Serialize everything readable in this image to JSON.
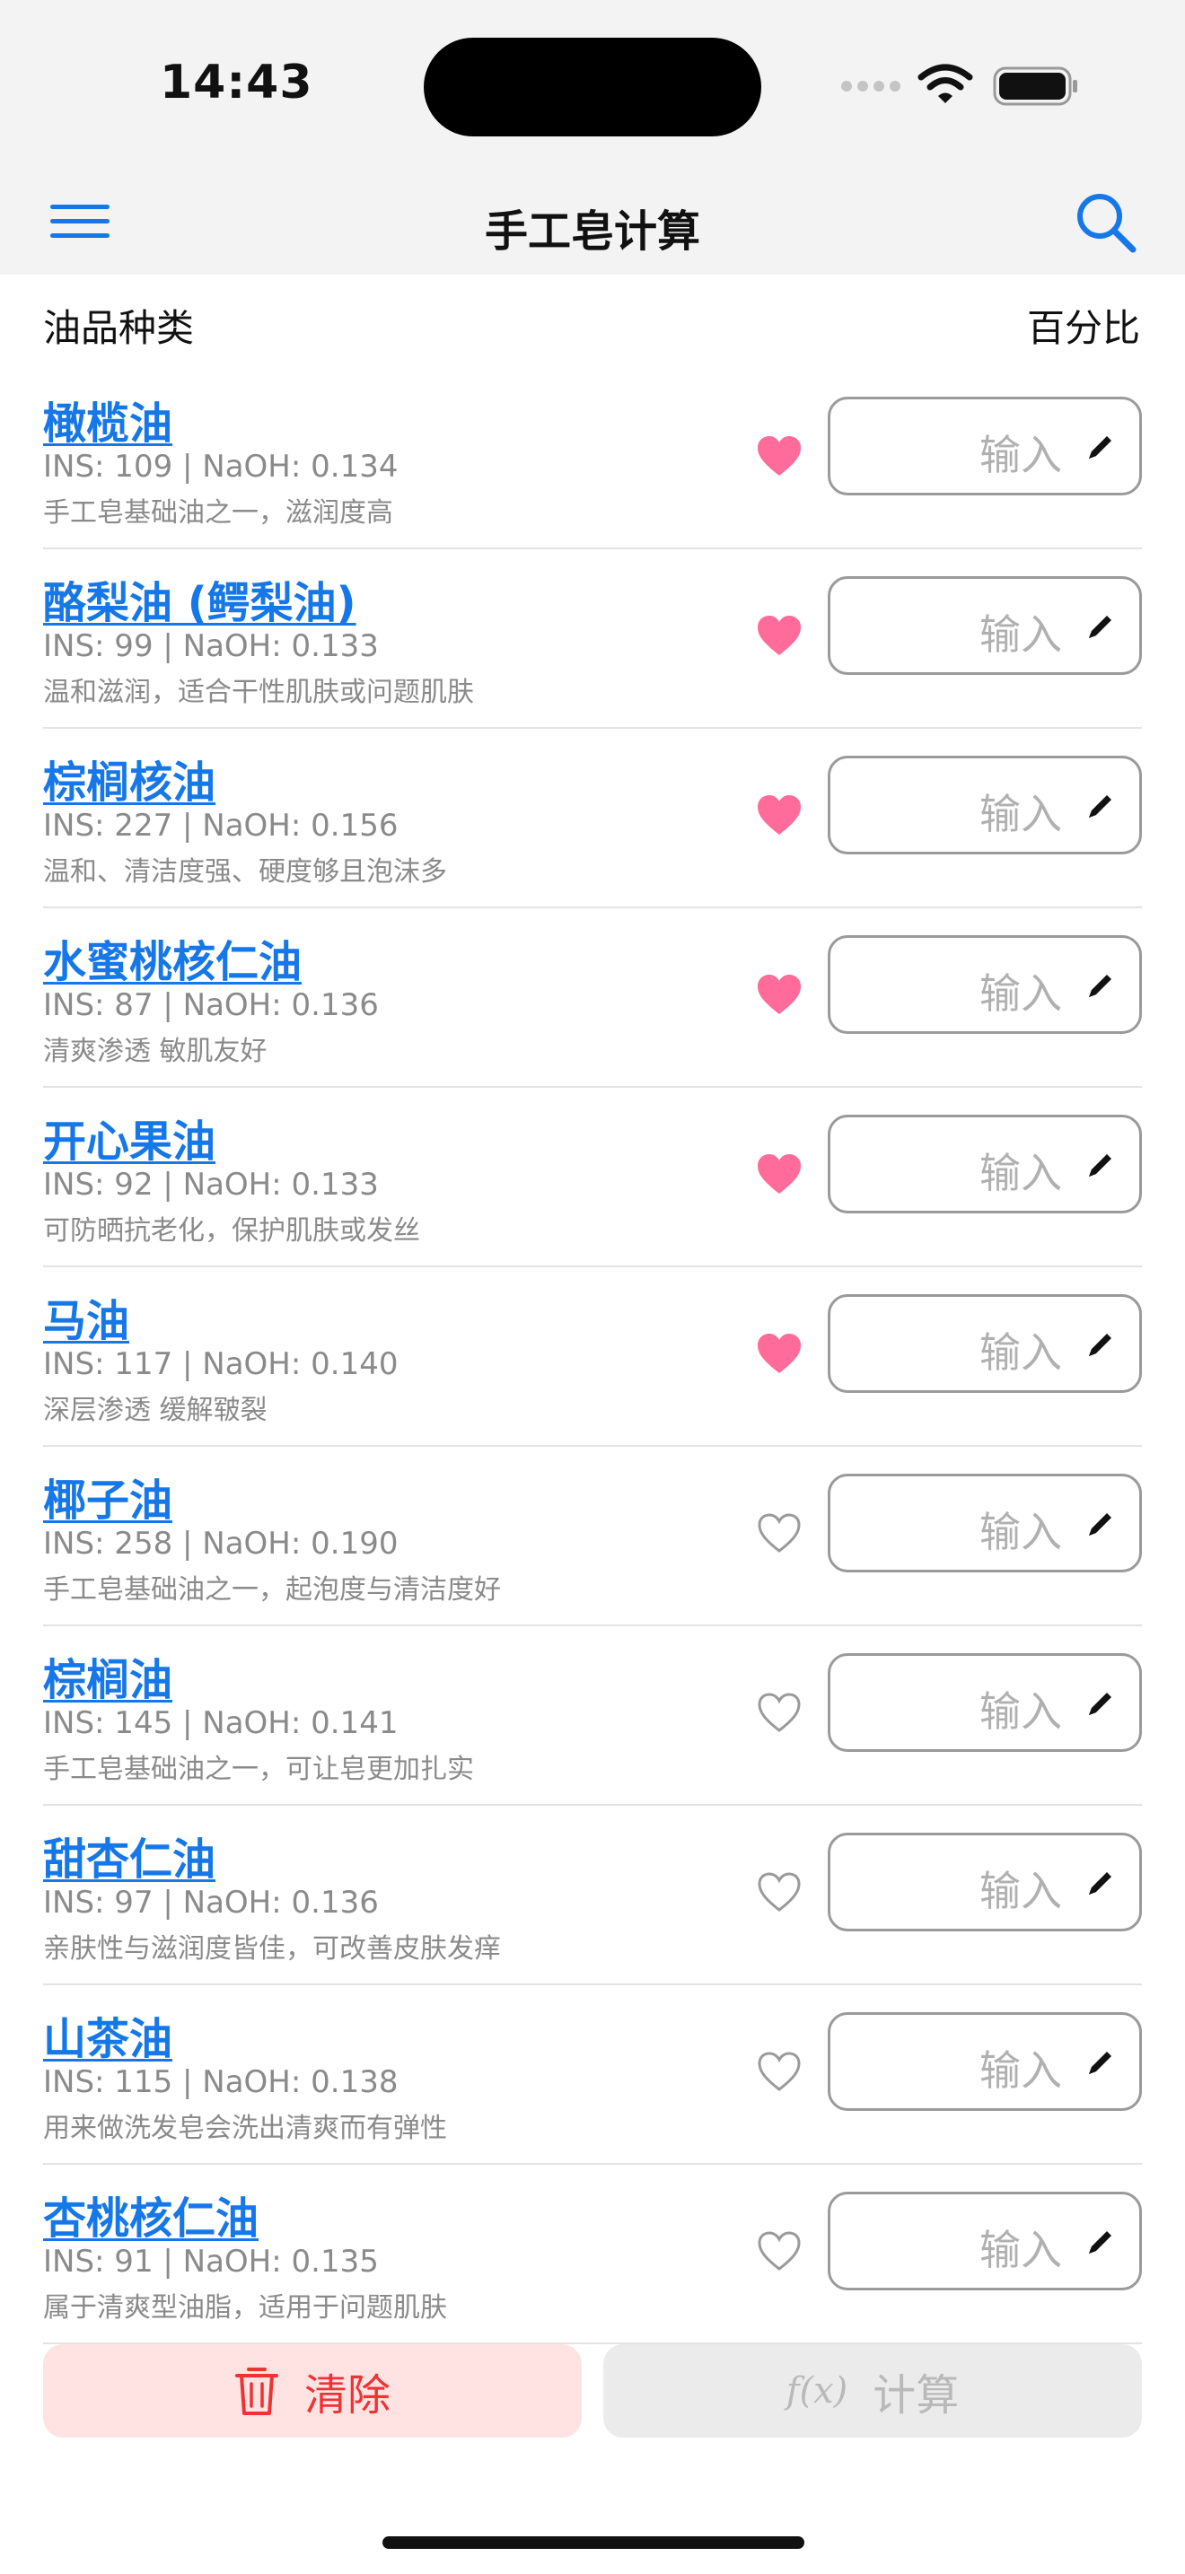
{
  "status": {
    "time": "14:43"
  },
  "nav": {
    "title": "手工皂计算"
  },
  "header": {
    "left": "油品种类",
    "right": "百分比"
  },
  "oils": [
    {
      "name": "橄榄油",
      "stats": "INS: 109 | NaOH: 0.134",
      "desc": "手工皂基础油之一，滋润度高",
      "favorite": true,
      "placeholder": "输入"
    },
    {
      "name": "酪梨油 (鳄梨油)",
      "stats": "INS: 99 | NaOH: 0.133",
      "desc": "温和滋润，适合干性肌肤或问题肌肤",
      "favorite": true,
      "placeholder": "输入"
    },
    {
      "name": "棕榈核油",
      "stats": "INS: 227 | NaOH: 0.156",
      "desc": "温和、清洁度强、硬度够且泡沫多",
      "favorite": true,
      "placeholder": "输入"
    },
    {
      "name": "水蜜桃核仁油",
      "stats": "INS: 87 | NaOH: 0.136",
      "desc": "清爽渗透 敏肌友好",
      "favorite": true,
      "placeholder": "输入"
    },
    {
      "name": "开心果油",
      "stats": "INS: 92 | NaOH: 0.133",
      "desc": "可防晒抗老化，保护肌肤或发丝",
      "favorite": true,
      "placeholder": "输入"
    },
    {
      "name": "马油",
      "stats": "INS: 117 | NaOH: 0.140",
      "desc": "深层渗透 缓解皲裂",
      "favorite": true,
      "placeholder": "输入"
    },
    {
      "name": "椰子油",
      "stats": "INS: 258 | NaOH: 0.190",
      "desc": "手工皂基础油之一，起泡度与清洁度好",
      "favorite": false,
      "placeholder": "输入"
    },
    {
      "name": "棕榈油",
      "stats": "INS: 145 | NaOH: 0.141",
      "desc": "手工皂基础油之一，可让皂更加扎实",
      "favorite": false,
      "placeholder": "输入"
    },
    {
      "name": "甜杏仁油",
      "stats": "INS: 97 | NaOH: 0.136",
      "desc": "亲肤性与滋润度皆佳，可改善皮肤发痒",
      "favorite": false,
      "placeholder": "输入"
    },
    {
      "name": "山茶油",
      "stats": "INS: 115 | NaOH: 0.138",
      "desc": "用来做洗发皂会洗出清爽而有弹性",
      "favorite": false,
      "placeholder": "输入"
    },
    {
      "name": "杏桃核仁油",
      "stats": "INS: 91 | NaOH: 0.135",
      "desc": "属于清爽型油脂，适用于问题肌肤",
      "favorite": false,
      "placeholder": "输入"
    }
  ],
  "actions": {
    "clear_label": "清除",
    "calc_label": "计算",
    "calc_icon": "f(x)"
  },
  "colors": {
    "link": "#1677e8",
    "heart": "#ff6b9a",
    "danger": "#ee3333",
    "danger_bg": "#ffe3e3",
    "disabled": "#b9b9b9"
  }
}
